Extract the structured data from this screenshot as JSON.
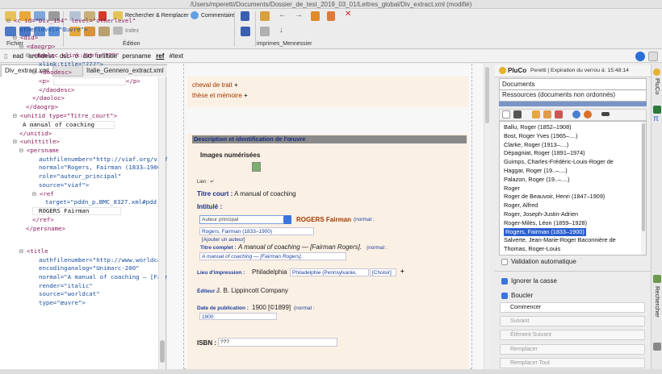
{
  "window_title": "/Users/mperetti/Documents/Dossier_de_test_2019_03_01/Lettres_global/Div_extract.xml (modifié)",
  "toolbar": {
    "find_replace": "Rechercher & Remplacer",
    "comment": "Commentaire",
    "index": "Index",
    "groups": {
      "file": "Fichier",
      "edit": "Édition",
      "print": "imprimes_Mennessier"
    }
  },
  "breadcrumb": [
    "ead",
    "archdesc",
    "dsc",
    "c",
    "did",
    "unittitle",
    "persname",
    "ref",
    "#text"
  ],
  "tabs": [
    "Div_extract.xml",
    "Italie_Gennero_extract.xml"
  ],
  "xml_lines": [
    {
      "t": "<c id=\"Div_154\" level=\"otherlevel\"",
      "c": "tg"
    },
    {
      "t": "otherlevel=\"Œuvre\">",
      "c": "at"
    },
    {
      "t": "<did>",
      "c": "tg"
    },
    {
      "t": "<daogrp>",
      "c": "tg"
    },
    {
      "t": "<daoloc xlink:href=\"???\"",
      "c": "tg"
    },
    {
      "t": "xlink:title=\"???\">",
      "c": "at"
    },
    {
      "t": "<daodesc>",
      "c": "tg"
    },
    {
      "t": "<p>",
      "c": "tg"
    },
    {
      "t": "</daodesc>",
      "c": "tg"
    },
    {
      "t": "</daoloc>",
      "c": "tg"
    },
    {
      "t": "</daogrp>",
      "c": "tg"
    },
    {
      "t": "<unitid type=\"Titre_court\">",
      "c": "tg"
    },
    {
      "t": "A manual of coaching",
      "c": "tx"
    },
    {
      "t": "</unitid>",
      "c": "tg"
    },
    {
      "t": "<unittitle>",
      "c": "tg"
    },
    {
      "t": "<persname",
      "c": "tg"
    },
    {
      "t": "authfilenumber=\"http://viaf.org/viaf/4",
      "c": "at"
    },
    {
      "t": "normal=\"Rogers, Fairman (1833–1900",
      "c": "at"
    },
    {
      "t": "role=\"auteur_principal\"",
      "c": "at"
    },
    {
      "t": "source=\"viaf\">",
      "c": "at"
    },
    {
      "t": "<ref",
      "c": "tg"
    },
    {
      "t": "target=\"pddn_p.BMC_8327.xml#pdd",
      "c": "at"
    },
    {
      "t": "ROGERS Fairman",
      "c": "tx"
    },
    {
      "t": "</ref>",
      "c": "tg"
    },
    {
      "t": "</persname>",
      "c": "tg"
    },
    {
      "t": "<title",
      "c": "tg"
    },
    {
      "t": "authfilenumber=\"http://www.worldcat",
      "c": "at"
    },
    {
      "t": "encodinganalog=\"Unimarc-200\"",
      "c": "at"
    },
    {
      "t": "normal=\"A manual of coaching — [Fair",
      "c": "at"
    },
    {
      "t": "render=\"italic\"",
      "c": "at"
    },
    {
      "t": "source=\"worldcat\"",
      "c": "at"
    },
    {
      "t": "type=\"œuvre\">",
      "c": "at"
    }
  ],
  "xml_close_p": "</p>",
  "form": {
    "items": [
      "cheval de trait",
      "thèse et mémoire"
    ],
    "section_title": "Description et identification de l'œuvre",
    "images_label": "Images numérisées",
    "lien_label": "Lien :",
    "titre_court_label": "Titre court :",
    "titre_court_value": "A manual of coaching",
    "intitule_label": "Intitulé :",
    "role_select": "Auteur principal",
    "author_name": "ROGERS Fairman",
    "normal_label": "(normal :",
    "author_normal": "Rogers, Fairman (1833–1900)",
    "add_author": "[Ajouter un auteur]",
    "titre_complet_label": "Titre complet :",
    "titre_complet_value": "A manual of coaching — [Fairman Rogers].",
    "titre_complet_normal": "A manual of coaching — [Fairman Rogers].",
    "lieu_label": "Lieu d'impression :",
    "lieu_value": "Philadelphia",
    "lieu_normal": "Philadelphie (Pennsylvanie,",
    "choisir": "[Choisir]",
    "editeur_label": "Éditeur :",
    "editeur_value": "J. B. Lippincott Company",
    "date_label": "Date de publication :",
    "date_value": "1900 [©1899]",
    "date_normal": "1900",
    "isbn_label": "ISBN :",
    "isbn_value": "???"
  },
  "pluco": {
    "title": "PluCo",
    "lock": "Peretti | Expiration du verrou à: 15:48:14",
    "top_list": [
      "Documents",
      "Ressources (documents non ordonnés)"
    ],
    "list": [
      "Ballu, Roger (1852–1908)",
      "Bost, Roger Yves (1965–....)",
      "Clarke, Roger (1913–....)",
      "Dépagniat, Roger (1891–1974)",
      "Guimps, Charles-Frédéric-Louis-Roger de",
      "Haggar, Roger (19..–....)",
      "Palazon, Roger (19..–....)",
      "Roger",
      "Roger de Beauvoir, Henri (1847–1909)",
      "Roger, Alfred",
      "Roger, Joseph-Justin-Adrien",
      "Roger-Milès, Léon (1859–1928)",
      "Rogers, Fairman (1833–1900)",
      "Salverte, Jean-Marie-Roger Baconnière de",
      "Thomas, Roger-Louis"
    ],
    "selected": 12,
    "auto_validation": "Validation automatique"
  },
  "search": {
    "ignore_case": "Ignorer la casse",
    "loop": "Boucler",
    "buttons": [
      "Commencer",
      "Suivant",
      "Élément Suivant",
      "Remplacer",
      "Remplacer Tout"
    ]
  },
  "side_tabs": [
    "PluCo",
    "Rechercher"
  ]
}
